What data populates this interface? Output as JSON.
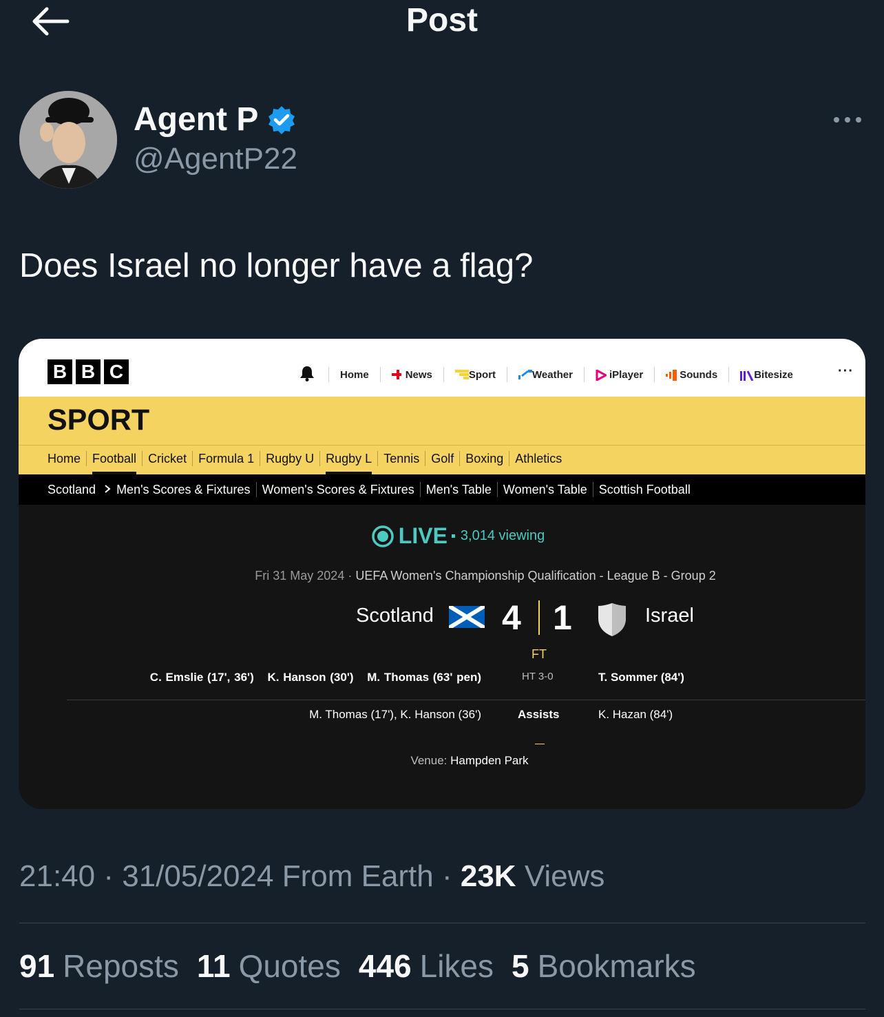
{
  "header": {
    "title": "Post",
    "back_icon": "arrow-left-icon"
  },
  "author": {
    "name": "Agent P",
    "handle": "@AgentP22",
    "verified_icon": "verified-badge-icon",
    "avatar": "avatar"
  },
  "post": {
    "text": "Does Israel no longer have a flag?",
    "time": "21:40",
    "date": "31/05/2024",
    "location": "From Earth",
    "views_count": "23K",
    "views_label": "Views"
  },
  "stats": {
    "reposts_count": "91",
    "reposts_label": "Reposts",
    "quotes_count": "11",
    "quotes_label": "Quotes",
    "likes_count": "446",
    "likes_label": "Likes",
    "bookmarks_count": "5",
    "bookmarks_label": "Bookmarks"
  },
  "embed": {
    "logo": [
      "B",
      "B",
      "C"
    ],
    "top_nav": [
      "Home",
      "News",
      "Sport",
      "Weather",
      "iPlayer",
      "Sounds",
      "Bitesize"
    ],
    "more": "···",
    "section": "SPORT",
    "sport_nav": [
      "Home",
      "Football",
      "Cricket",
      "Formula 1",
      "Rugby U",
      "Rugby L",
      "Tennis",
      "Golf",
      "Boxing",
      "Athletics"
    ],
    "sub_nav": {
      "root": "Scotland",
      "items": [
        "Men's Scores & Fixtures",
        "Women's Scores & Fixtures",
        "Men's Table",
        "Women's Table",
        "Scottish Football"
      ]
    },
    "live": {
      "label": "LIVE",
      "viewing": "3,014 viewing",
      "accent": "#4cc9c0"
    },
    "match": {
      "date": "Fri 31 May 2024",
      "competition": "UEFA Women's Championship Qualification - League B - Group 2",
      "home_team": "Scotland",
      "away_team": "Israel",
      "home_score": "4",
      "away_score": "1",
      "status": "FT",
      "half_time": "HT 3-0",
      "home_scorers": [
        "C. Emslie (17', 36')",
        "K. Hanson (30')",
        "M. Thomas (63' pen)"
      ],
      "away_scorers": [
        "T. Sommer (84')"
      ],
      "assists_label": "Assists",
      "home_assists": "M. Thomas (17'), K. Hanson (36')",
      "away_assists": "K. Hazan (84')",
      "venue_label": "Venue:",
      "venue": "Hampden Park"
    }
  },
  "colors": {
    "background": "#15202b",
    "secondary_text": "#8b98a5",
    "verified": "#1d9bf0",
    "sport_yellow": "#f5d361"
  }
}
